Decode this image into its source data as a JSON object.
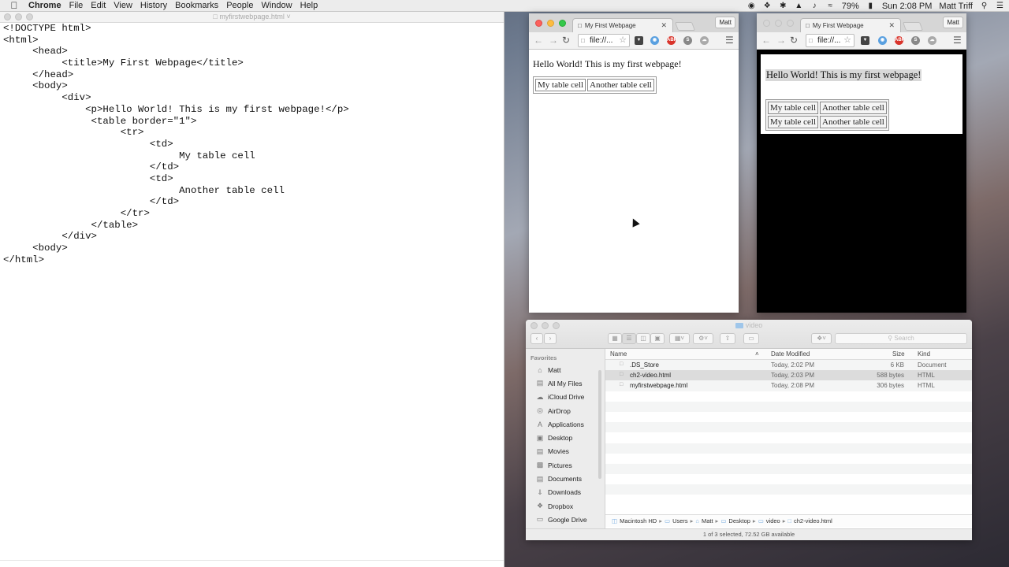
{
  "menubar": {
    "apple_icon": "apple-logo",
    "items": [
      "Chrome",
      "File",
      "Edit",
      "View",
      "History",
      "Bookmarks",
      "People",
      "Window",
      "Help"
    ],
    "battery": "79%",
    "clock": "Sun 2:08 PM",
    "user": "Matt Triff"
  },
  "editor": {
    "title": "myfirstwebpage.html",
    "lines": [
      "<!DOCTYPE html>",
      "<html>",
      "     <head>",
      "          <title>My First Webpage</title>",
      "     </head>",
      "     <body>",
      "          <div>",
      "              <p>Hello World! This is my first webpage!</p>",
      "               <table border=\"1\">",
      "                    <tr>",
      "                         <td>",
      "                              My table cell",
      "                         </td>",
      "                         <td>",
      "                              Another table cell",
      "                         </td>",
      "                    </tr>",
      "               </table>",
      "          </div>",
      "     <body>",
      "</html>"
    ]
  },
  "browser1": {
    "tab_title": "My First Webpage",
    "profile": "Matt",
    "url": "file://...",
    "page": {
      "paragraph": "Hello World! This is my first webpage!",
      "cells": [
        [
          "My table cell",
          "Another table cell"
        ]
      ]
    }
  },
  "browser2": {
    "tab_title": "My First Webpage",
    "profile": "Matt",
    "url": "file://...",
    "page": {
      "paragraph": "Hello World! This is my first webpage!",
      "cells": [
        [
          "My table cell",
          "Another table cell"
        ],
        [
          "My table cell",
          "Another table cell"
        ]
      ]
    }
  },
  "finder": {
    "title": "video",
    "search_placeholder": "Search",
    "favorites_label": "Favorites",
    "sidebar": [
      "Matt",
      "All My Files",
      "iCloud Drive",
      "AirDrop",
      "Applications",
      "Desktop",
      "Movies",
      "Pictures",
      "Documents",
      "Downloads",
      "Dropbox",
      "Google Drive"
    ],
    "columns": {
      "name": "Name",
      "date": "Date Modified",
      "size": "Size",
      "kind": "Kind"
    },
    "files": [
      {
        "name": ".DS_Store",
        "date": "Today, 2:02 PM",
        "size": "6 KB",
        "kind": "Document"
      },
      {
        "name": "ch2-video.html",
        "date": "Today, 2:03 PM",
        "size": "588 bytes",
        "kind": "HTML"
      },
      {
        "name": "myfirstwebpage.html",
        "date": "Today, 2:08 PM",
        "size": "306 bytes",
        "kind": "HTML"
      }
    ],
    "path": [
      "Macintosh HD",
      "Users",
      "Matt",
      "Desktop",
      "video",
      "ch2-video.html"
    ],
    "status": "1 of 3 selected, 72.52 GB available"
  }
}
